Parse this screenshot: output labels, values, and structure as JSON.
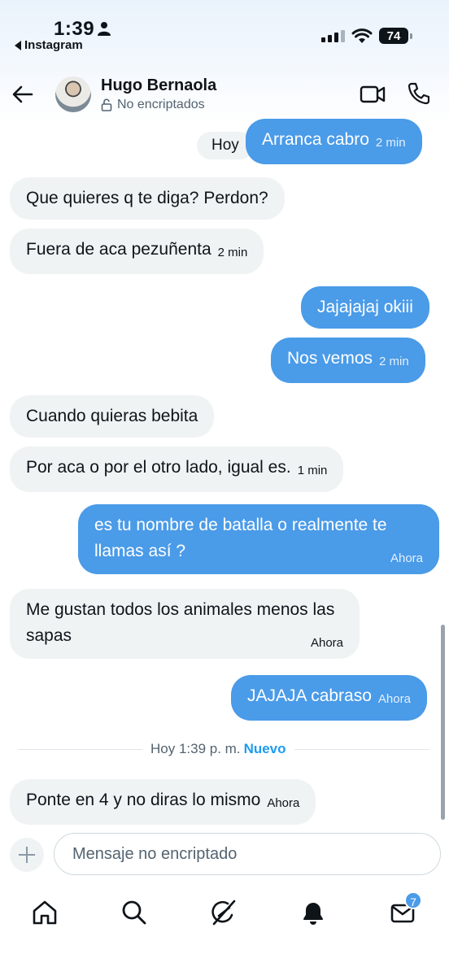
{
  "status_bar": {
    "time": "1:39",
    "back_app": "Instagram",
    "battery": "74"
  },
  "header": {
    "contact_name": "Hugo Bernaola",
    "encryption_status": "No encriptados"
  },
  "chat": {
    "day_label": "Hoy",
    "messages": [
      {
        "dir": "out",
        "text": "Arranca cabro",
        "time": "2 min"
      },
      {
        "dir": "in",
        "text": "Que quieres q te diga? Perdon?",
        "time": ""
      },
      {
        "dir": "in",
        "text": "Fuera de aca pezuñenta",
        "time": "2 min"
      },
      {
        "dir": "out",
        "text": "Jajajajaj okiii",
        "time": ""
      },
      {
        "dir": "out",
        "text": "Nos vemos",
        "time": "2 min"
      },
      {
        "dir": "in",
        "text": "Cuando quieras bebita",
        "time": ""
      },
      {
        "dir": "in",
        "text": "Por aca o por el otro lado, igual es.",
        "time": "1 min"
      },
      {
        "dir": "out",
        "text": "es tu nombre de batalla o realmente te llamas así ?",
        "time": "Ahora"
      },
      {
        "dir": "in",
        "text": "Me gustan todos los animales menos las sapas",
        "time": "Ahora"
      },
      {
        "dir": "out",
        "text": "JAJAJA cabraso",
        "time": "Ahora"
      },
      {
        "dir": "in",
        "text": "Ponte en 4 y no diras lo mismo",
        "time": "Ahora"
      }
    ],
    "divider": {
      "time": "Hoy 1:39 p. m.",
      "new_label": "Nuevo"
    }
  },
  "composer": {
    "placeholder": "Mensaje no encriptado",
    "value": ""
  },
  "tab_bar": {
    "items": [
      {
        "icon": "home-icon"
      },
      {
        "icon": "search-icon"
      },
      {
        "icon": "grok-icon"
      },
      {
        "icon": "notifications-bell-icon"
      },
      {
        "icon": "messages-mail-icon"
      }
    ],
    "messages_badge": "7"
  },
  "colors": {
    "outgoing_bubble": "#4a9be8",
    "incoming_bubble": "#eff3f4",
    "accent": "#1d9bf0"
  }
}
